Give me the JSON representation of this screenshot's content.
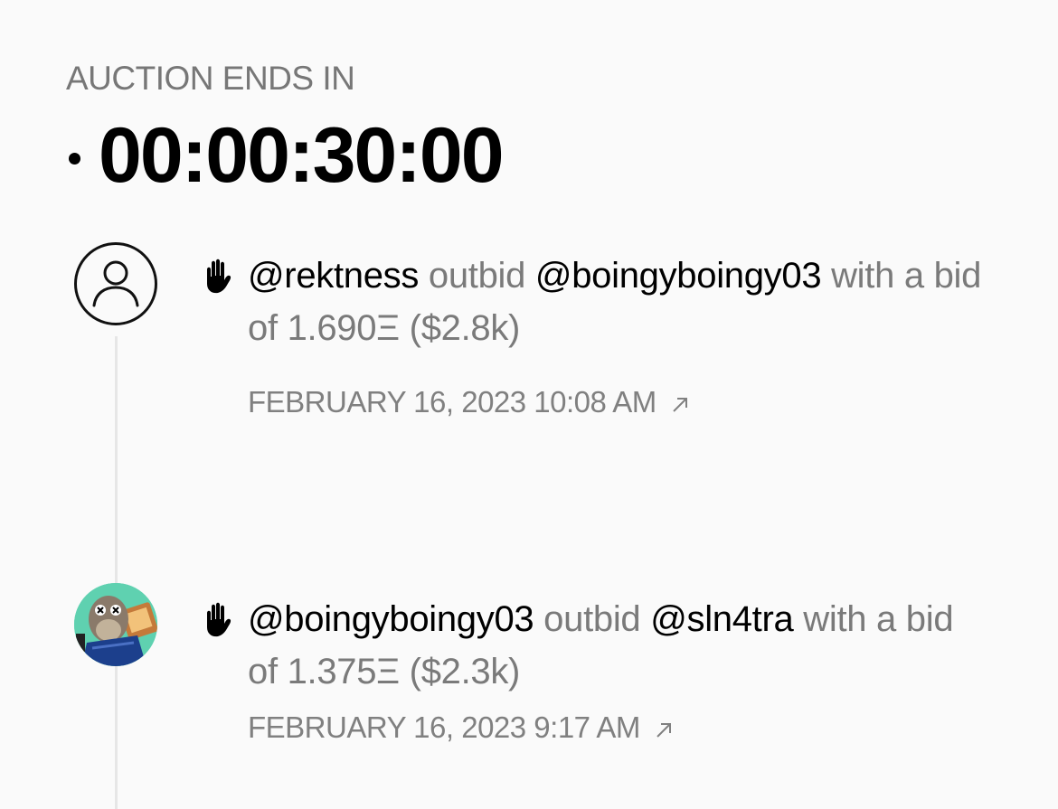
{
  "auction": {
    "label": "AUCTION ENDS IN",
    "countdown": "00:00:30:00"
  },
  "events": [
    {
      "actor": "@rektness",
      "verb": "outbid",
      "target": "@boingyboingy03",
      "bid_text": "with a bid of 1.690Ξ ($2.8k)",
      "timestamp": "FEBRUARY 16, 2023 10:08 AM",
      "avatar": "default-user-icon",
      "icon": "raised-hand-icon"
    },
    {
      "actor": "@boingyboingy03",
      "verb": "outbid",
      "target": "@sln4tra",
      "bid_text": "with a bid of 1.375Ξ ($2.3k)",
      "timestamp": "FEBRUARY 16, 2023 9:17 AM",
      "avatar": "ape-avatar",
      "icon": "raised-hand-icon"
    }
  ],
  "colors": {
    "background": "#fafafa",
    "muted_text": "#7a7a7a",
    "primary_text": "#000000",
    "timeline_line": "#e6e6e6",
    "ape_avatar_bg": "#5fd1b0"
  }
}
